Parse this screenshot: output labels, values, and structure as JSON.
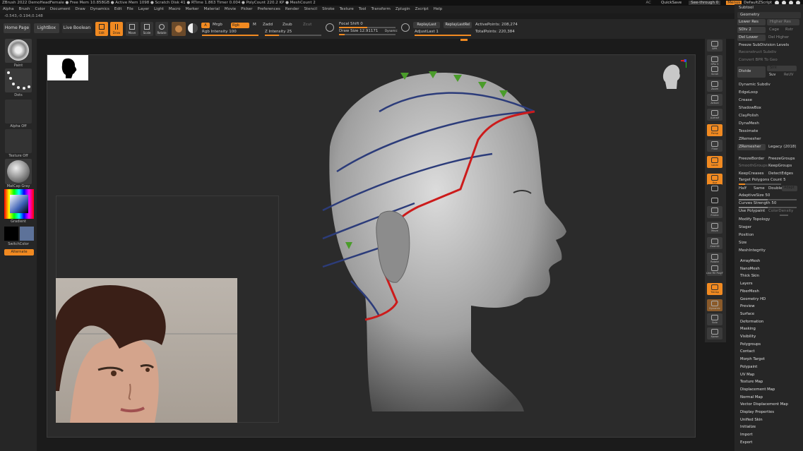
{
  "title_bar": {
    "text": "ZBrush 2022   DemoHeadFemale   ● Free Mem 10.858GB ● Active Mem 1098 ● Scratch Disk 41 ● RTime 1.863 Timer 0.004 ● PolyCount 220.2 KP ● MeshCount 2",
    "right": {
      "ac": "AC",
      "quicksave": "QuickSave",
      "seethrough": "See-through  0",
      "menus": "Menus",
      "script": "DefaultZScript"
    }
  },
  "menu": [
    "Alpha",
    "Brush",
    "Color",
    "Document",
    "Draw",
    "Dynamics",
    "Edit",
    "File",
    "Layer",
    "Light",
    "Macro",
    "Marker",
    "Material",
    "Movie",
    "Picker",
    "Preferences",
    "Render",
    "Stencil",
    "Stroke",
    "Texture",
    "Tool",
    "Transform",
    "Zplugin",
    "Zscript",
    "Help"
  ],
  "coords": "-0.543,-0.194,0.148",
  "toolbar": {
    "home": "Home Page",
    "lightbox": "LightBox",
    "livebool": "Live Boolean",
    "edit": "Edit",
    "draw": "Draw",
    "move": "Move",
    "scale": "Scale",
    "rotate": "Rotate",
    "a": "A",
    "mrgb": "Mrgb",
    "rgb": "Rgb",
    "m": "M",
    "zadd": "Zadd",
    "zsub": "Zsub",
    "zcut": "Zcut",
    "rgb_intensity": "Rgb Intensity 100",
    "z_intensity": "Z Intensity 25",
    "focal": "Focal Shift 0",
    "drawsize": "Draw Size 12.91171",
    "dynamic": "Dynamic",
    "replaylast": "ReplayLast",
    "replaylastrel": "ReplayLastRel",
    "adjustlast": "AdjustLast 1",
    "active": "ActivePoints: 208,274",
    "total": "TotalPoints: 220,384"
  },
  "left": {
    "paint": "Paint",
    "dots": "Dots",
    "alpha": "Alpha Off",
    "texture": "Texture Off",
    "matcap": "MatCap Gray",
    "gradient": "Gradient",
    "switch": "SwitchColor",
    "alternate": "Alternate"
  },
  "strip": [
    "BPR",
    "SPix 3",
    "Scroll",
    "Zoom",
    "Actual",
    "AAHalf",
    "Persp",
    "Floor",
    "Local",
    "Xyz",
    "",
    "",
    "Frame",
    "Move",
    "ZoomD",
    "Rotate",
    "Line Fill PolyF",
    "Transp",
    "Dynamic",
    "Solo",
    "Xpose"
  ],
  "geometry": {
    "subtool": "Subtool",
    "header": "Geometry",
    "lower": "Lower Res",
    "higher": "Higher Res",
    "sdiv": "SDiv 2",
    "cage": "Cage",
    "rstr": "Rstr",
    "del_lower": "Del Lower",
    "del_higher": "Del Higher",
    "freeze": "Freeze SubDivision Levels",
    "reconstruct": "Reconstruct Subdiv",
    "convert": "Convert BPR To Geo",
    "divide": "Divide",
    "smt": "Smt",
    "suv": "Suv",
    "reuv": "ReUV",
    "items": [
      "Dynamic Subdiv",
      "EdgeLoop",
      "Crease",
      "ShadowBox",
      "ClayPolish",
      "DynaMesh",
      "Tessimate",
      "ZRemesher"
    ],
    "zremesher": "ZRemesher",
    "legacy": "Legacy (2018)",
    "freezeborder": "FreezeBorder",
    "freezegroups": "FreezeGroups",
    "smoothgroups": "SmoothGroups",
    "keepgroups": "KeepGroups",
    "keepcreases": "KeepCreases",
    "detectedges": "DetectEdges",
    "target": "Target Polygons Count 5",
    "half": "Half",
    "same": "Same",
    "double": "Double",
    "adapt": "Adapt",
    "adaptive": "AdaptiveSize 50",
    "curves": "Curves Strength 50",
    "usepolypaint": "Use Polypaint",
    "colordensity": "ColorDensity",
    "items2": [
      "Modify Topology",
      "Stager",
      "Position",
      "Size",
      "MeshIntegrity"
    ]
  },
  "palettes": [
    "ArrayMesh",
    "NanoMesh",
    "Thick Skin",
    "Layers",
    "FiberMesh",
    "Geometry HD",
    "Preview",
    "Surface",
    "Deformation",
    "Masking",
    "Visibility",
    "Polygroups",
    "Contact",
    "Morph Target",
    "Polypaint",
    "UV Map",
    "Texture Map",
    "Displacement Map",
    "Normal Map",
    "Vector Displacement Map",
    "Display Properties",
    "Unified Skin",
    "Initialize",
    "Import",
    "Export"
  ]
}
